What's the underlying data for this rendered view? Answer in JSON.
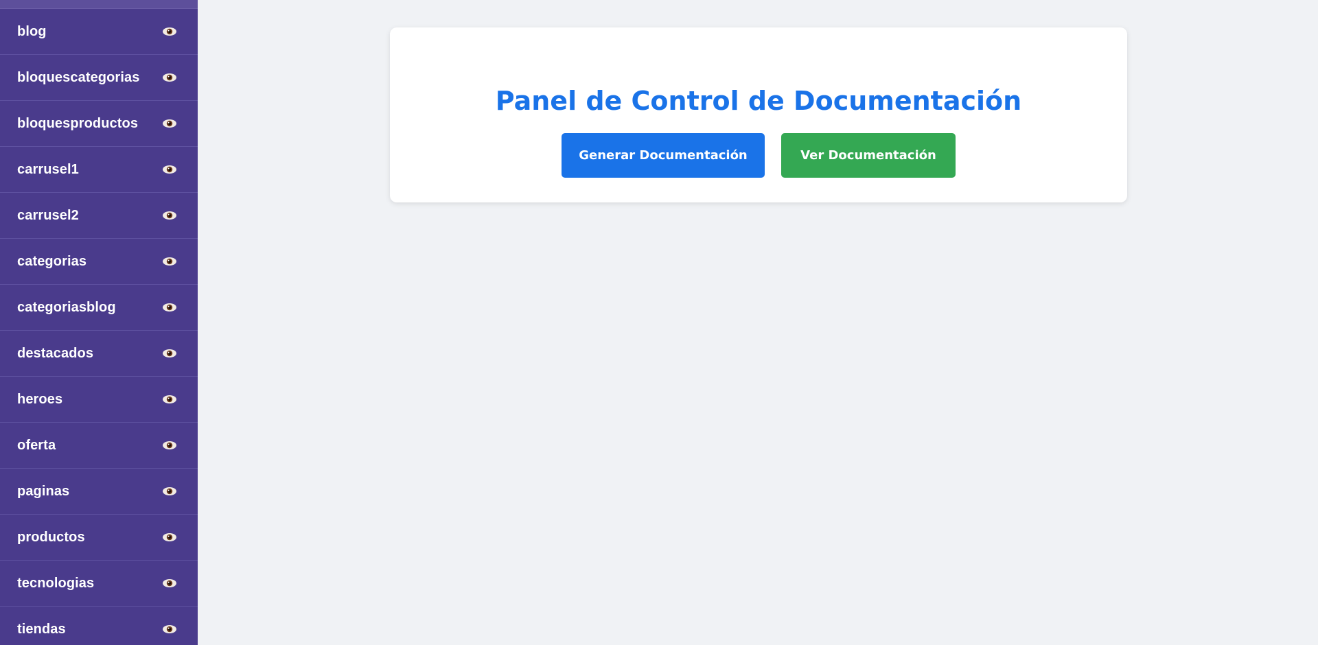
{
  "sidebar": {
    "items": [
      {
        "label": "blog",
        "icon": "eye-icon"
      },
      {
        "label": "bloquescategorias",
        "icon": "eye-icon"
      },
      {
        "label": "bloquesproductos",
        "icon": "eye-icon"
      },
      {
        "label": "carrusel1",
        "icon": "eye-icon"
      },
      {
        "label": "carrusel2",
        "icon": "eye-icon"
      },
      {
        "label": "categorias",
        "icon": "eye-icon"
      },
      {
        "label": "categoriasblog",
        "icon": "eye-icon"
      },
      {
        "label": "destacados",
        "icon": "eye-icon"
      },
      {
        "label": "heroes",
        "icon": "eye-icon"
      },
      {
        "label": "oferta",
        "icon": "eye-icon"
      },
      {
        "label": "paginas",
        "icon": "eye-icon"
      },
      {
        "label": "productos",
        "icon": "eye-icon"
      },
      {
        "label": "tecnologias",
        "icon": "eye-icon"
      },
      {
        "label": "tiendas",
        "icon": "eye-icon"
      }
    ]
  },
  "main": {
    "title": "Panel de Control de Documentación",
    "buttons": {
      "generate_label": "Generar Documentación",
      "view_label": "Ver Documentación"
    }
  },
  "colors": {
    "sidebar_bg": "#4a3b8c",
    "page_bg": "#f0f2f5",
    "title": "#1a73e8",
    "generate_button": "#1a73e8",
    "view_button": "#34a853"
  }
}
